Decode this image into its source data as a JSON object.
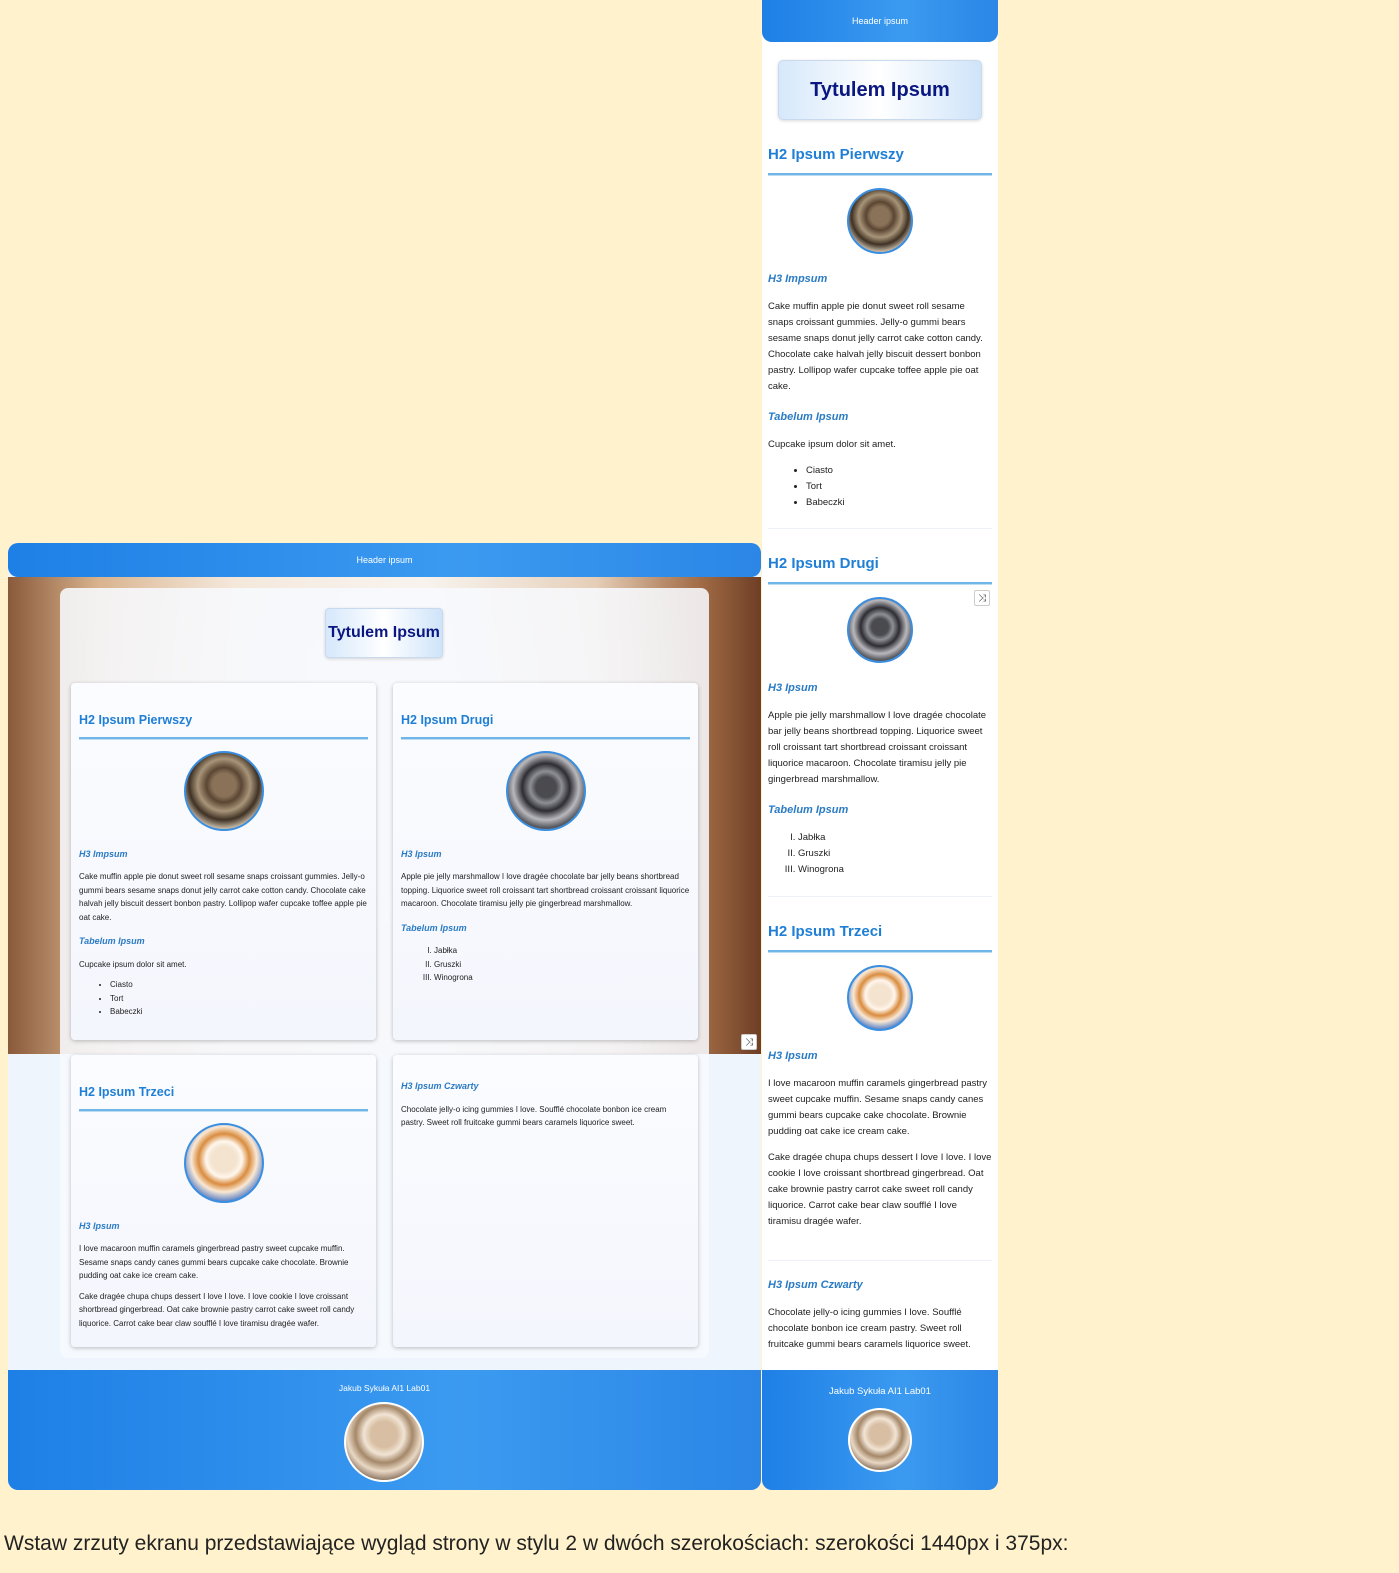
{
  "header": "Header ipsum",
  "title": "Tytulem Ipsum",
  "footer": "Jakub Sykuła AI1 Lab01",
  "shuffle_glyph": "⤨",
  "sections": [
    {
      "h2": "H2 Ipsum Pierwszy",
      "h3": "H3 Impsum",
      "paragraphs": [
        "Cake muffin apple pie donut sweet roll sesame snaps croissant gummies. Jelly-o gummi bears sesame snaps donut jelly carrot cake cotton candy. Chocolate cake halvah jelly biscuit dessert bonbon pastry. Lollipop wafer cupcake toffee apple pie oat cake."
      ],
      "h3b": "Tabelum Ipsum",
      "intro": "Cupcake ipsum dolor sit amet.",
      "list": [
        "Ciasto",
        "Tort",
        "Babeczki"
      ]
    },
    {
      "h2": "H2 Ipsum Drugi",
      "h3": "H3 Ipsum",
      "paragraphs": [
        "Apple pie jelly marshmallow I love dragée chocolate bar jelly beans shortbread topping. Liquorice sweet roll croissant tart shortbread croissant croissant liquorice macaroon. Chocolate tiramisu jelly pie gingerbread marshmallow."
      ],
      "h3b": "Tabelum Ipsum",
      "list": [
        "Jabłka",
        "Gruszki",
        "Winogrona"
      ]
    },
    {
      "h2": "H2 Ipsum Trzeci",
      "h3": "H3 Ipsum",
      "paragraphs": [
        "I love macaroon muffin caramels gingerbread pastry sweet cupcake muffin. Sesame snaps candy canes gummi bears cupcake cake chocolate. Brownie pudding oat cake ice cream cake.",
        "Cake dragée chupa chups dessert I love I love. I love cookie I love croissant shortbread gingerbread. Oat cake brownie pastry carrot cake sweet roll candy liquorice. Carrot cake bear claw soufflé I love tiramisu dragée wafer."
      ]
    },
    {
      "h3": "H3 Ipsum Czwarty",
      "paragraphs": [
        "Chocolate jelly-o icing gummies I love. Soufflé chocolate bonbon ice cream pastry. Sweet roll fruitcake gummi bears caramels liquorice sweet."
      ]
    }
  ],
  "caption": "Wstaw zrzuty ekranu przedstawiające wygląd strony w stylu 2 w dwóch szerokościach: szerokości 1440px i 375px:"
}
